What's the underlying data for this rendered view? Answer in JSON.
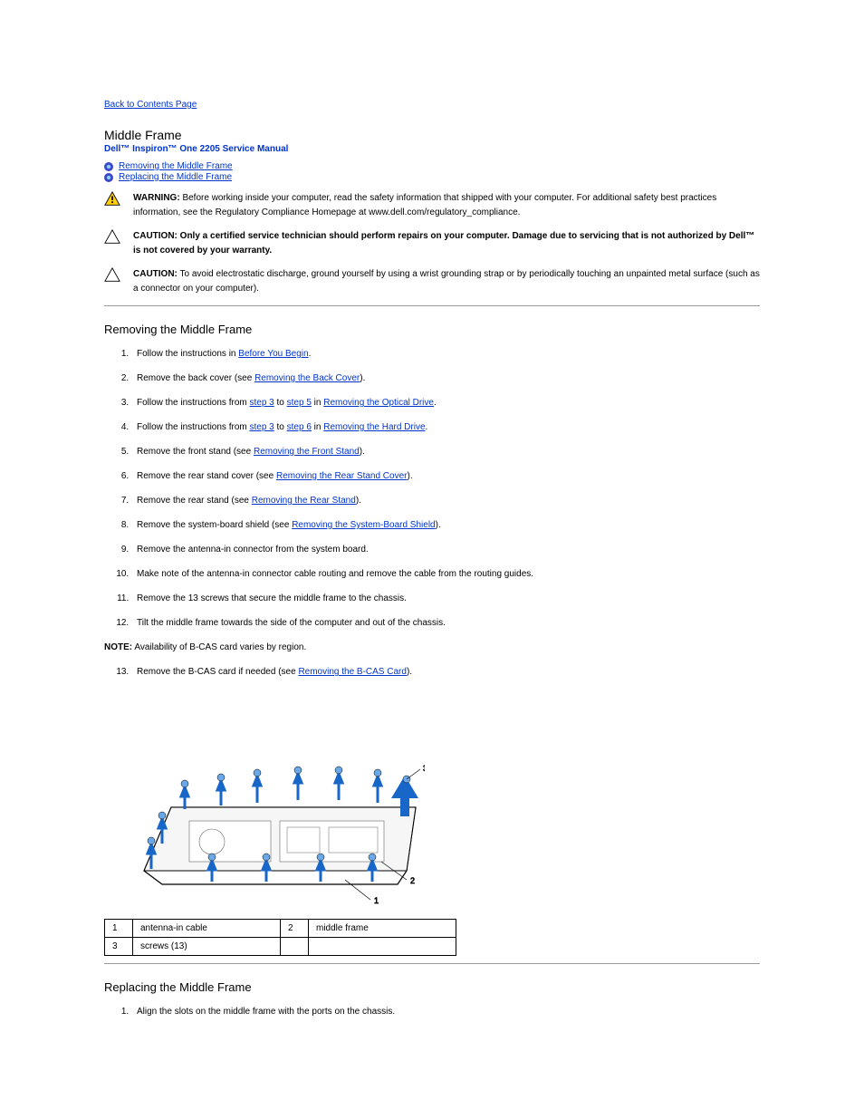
{
  "nav": {
    "back": "Back to Contents Page"
  },
  "title": "Middle Frame",
  "subtitle": "Dell™ Inspiron™ One 2205 Service Manual",
  "toc": [
    {
      "label": "Removing the Middle Frame"
    },
    {
      "label": "Replacing the Middle Frame"
    }
  ],
  "warnings": [
    {
      "type": "warning",
      "lead": "WARNING:",
      "text_before_link": "Before working inside your computer, read the safety information that shipped with your computer. For additional safety best practices information, see the Regulatory Compliance Homepage at www.dell.com/regulatory_compliance."
    },
    {
      "type": "caution",
      "lead": "CAUTION:",
      "text_before_link": "Only a certified service technician should perform repairs on your computer. Damage due to servicing that is not authorized by Dell™ is not covered by your warranty."
    },
    {
      "type": "caution",
      "lead": "CAUTION:",
      "text_before_link": "To avoid electrostatic discharge, ground yourself by using a wrist grounding strap or by periodically touching an unpainted metal surface (such as a connector on your computer)."
    }
  ],
  "sections": {
    "remove": {
      "heading": "Removing the Middle Frame",
      "steps": [
        {
          "text": "Follow the instructions in ",
          "link": "Before You Begin",
          "suffix": "."
        },
        {
          "text": "Remove the back cover (see ",
          "link": "Removing the Back Cover",
          "suffix": ")."
        },
        {
          "text": "Follow the instructions from ",
          "link1": "step 3",
          "mid": " to ",
          "link2": "step 5",
          "mid2": " in ",
          "link3": "Removing the Optical Drive",
          "suffix": "."
        },
        {
          "text": "Follow the instructions from ",
          "link1": "step 3",
          "mid": " to ",
          "link2": "step 6",
          "mid2": " in ",
          "link3": "Removing the Hard Drive",
          "suffix": "."
        },
        {
          "text": "Remove the front stand (see ",
          "link": "Removing the Front Stand",
          "suffix": ")."
        },
        {
          "text": "Remove the rear stand cover (see ",
          "link": "Removing the Rear Stand Cover",
          "suffix": ")."
        },
        {
          "text": "Remove the rear stand (see ",
          "link": "Removing the Rear Stand",
          "suffix": ")."
        },
        {
          "text": "Remove the system-board shield (see ",
          "link": "Removing the System-Board Shield",
          "suffix": ")."
        },
        {
          "text": "Remove the antenna-in connector from the system board."
        },
        {
          "text": "Make note of the antenna-in connector cable routing and remove the cable from the routing guides."
        },
        {
          "text": "Remove the 13 screws that secure the middle frame to the chassis."
        },
        {
          "text": "Tilt the middle frame towards the side of the computer and out of the chassis."
        },
        {
          "text": "Remove the B-CAS card if needed (see ",
          "link": "Removing the B-CAS Card",
          "suffix": ")."
        }
      ],
      "note": {
        "lead": "NOTE:",
        "text": "Availability of B-CAS card varies by region."
      }
    },
    "replace": {
      "heading": "Replacing the Middle Frame",
      "steps": [
        {
          "text": "Align the slots on the middle frame with the ports on the chassis."
        }
      ]
    }
  },
  "parts_table": {
    "rows": [
      {
        "n1": "1",
        "l1": "antenna-in cable",
        "n2": "2",
        "l2": "middle frame"
      },
      {
        "n1": "3",
        "l1": "screws (13)"
      }
    ]
  }
}
